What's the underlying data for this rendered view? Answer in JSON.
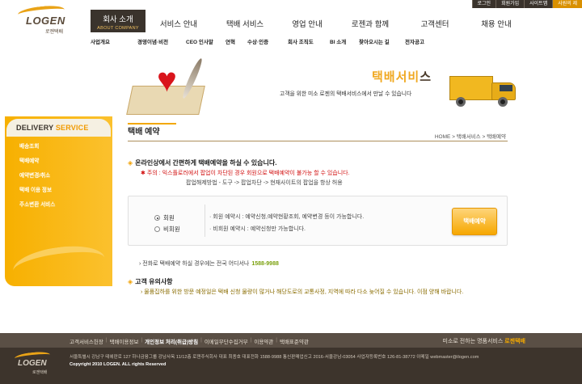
{
  "header": {
    "logo": {
      "brand": "LOGEN",
      "sub": "로젠택배"
    },
    "util_links": [
      "로그인",
      "회원가입",
      "사이트맵",
      "사원의 제"
    ],
    "gnb": [
      {
        "label": "회사 소개",
        "sub": "ABOUT COMPANY",
        "active": true
      },
      {
        "label": "서비스 안내"
      },
      {
        "label": "택배 서비스"
      },
      {
        "label": "영업 안내"
      },
      {
        "label": "로젠과 함께"
      },
      {
        "label": "고객센터"
      },
      {
        "label": "채용 안내"
      }
    ],
    "lnb": [
      "사업개요",
      "경영이념·비전",
      "CEO 인사말",
      "연혁",
      "수상·인증",
      "회사 조직도",
      "BI 소개",
      "찾아오시는 길",
      "전자공고"
    ]
  },
  "banner": {
    "title_main": "택배서비",
    "title_end": "스",
    "description": "고객을 위한 미소 로젠의 택배서비스에서 만날 수 있습니다"
  },
  "sidebar": {
    "title_a": "DELIVERY ",
    "title_b": "SERVICE",
    "items": [
      "배송조회",
      "택배예약",
      "예약변경/취소",
      "택배 이용 정보",
      "주소변환 서비스"
    ]
  },
  "main": {
    "page_title": "택배 예약",
    "breadcrumb": "HOME > 택배서비스 > 택배예약",
    "notice_1": "온라인상에서 간편하게 택배예약을 하실 수 있습니다.",
    "warning": "주의 : 익스플로러에서 팝업이 차단된 경우 회원으로 택배예약이 불가능 할 수 있습니다.",
    "help": "팝업해제방법 - 도구 -> 팝업차단 -> 현재사이트의 팝업을 항상 허용",
    "radio_member": "회원",
    "radio_guest": "비회원",
    "info_member": "회원 예약시 : 예약신청,예약현황조회, 예약변경 등이 가능합니다.",
    "info_guest": "비회원 예약시 : 예약신청만 가능합니다.",
    "reserve_button": "택배예약",
    "phone_text": "전화로 택배예약 하실 경우에는 전국 어디서나",
    "phone_number": "1588-9988",
    "notice_2_title": "고객 유의사항",
    "notice_2_body": "물품집하를 위한 방문 예정일은 택배 신청 물량이 많거나 해당도로의 교통사정, 지역에 따라 다소 늦어질 수 있습니다. 이점 양해 바랍니다."
  },
  "footer": {
    "links": [
      "고객서비스헌장",
      "택배이용정보",
      "개인정보 처리(취급)방침",
      "이메일무단수집거부",
      "이용약관",
      "택배표준약관"
    ],
    "slogan_a": "미소로 전하는 명품서비스 ",
    "slogan_b": "로젠택배",
    "logo_brand": "LOGEN",
    "logo_sub": "로젠택배",
    "address": "서울특별시 강남구 테헤란로 127 하나금융그룹 강남사옥 11/12층 로젠주식회사 대표 최종호 대표전화 1588-9988 통신판매업신고 2016-서울강남-03054 사업자등록번호 126-81-38772 이메일 webmaster@ilogen.com",
    "copyright": "Copyright 2010 LOGEN. ALL rights Reserved"
  }
}
